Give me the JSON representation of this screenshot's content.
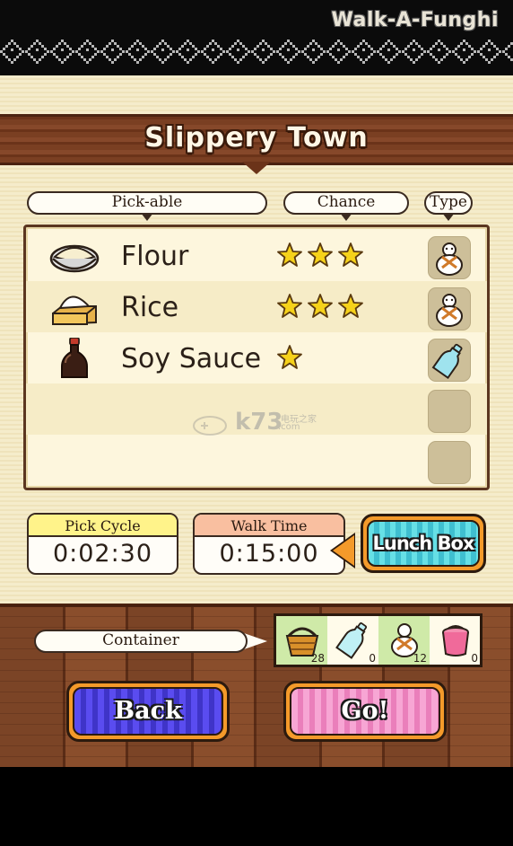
{
  "app": {
    "title": "Walk-A-Funghi"
  },
  "location": {
    "title": "Slippery Town"
  },
  "table_headers": {
    "pickable": "Pick-able",
    "chance": "Chance",
    "type": "Type"
  },
  "items": [
    {
      "name": "Flour",
      "icon": "flour-bowl-icon",
      "chance_stars": 3,
      "type_icon": "sack-icon"
    },
    {
      "name": "Rice",
      "icon": "rice-box-icon",
      "chance_stars": 3,
      "type_icon": "sack-icon"
    },
    {
      "name": "Soy Sauce",
      "icon": "soy-sauce-bottle-icon",
      "chance_stars": 1,
      "type_icon": "bottle-icon"
    },
    {
      "name": "",
      "icon": "",
      "chance_stars": 0,
      "type_icon": ""
    },
    {
      "name": "",
      "icon": "",
      "chance_stars": 0,
      "type_icon": ""
    }
  ],
  "pick_cycle": {
    "label": "Pick Cycle",
    "value": "0:02:30"
  },
  "walk_time": {
    "label": "Walk Time",
    "value": "0:15:00"
  },
  "lunch_box": {
    "label": "Lunch Box"
  },
  "container": {
    "label": "Container",
    "slots": [
      {
        "icon": "basket-icon",
        "count": "28"
      },
      {
        "icon": "bottle-icon",
        "count": "0"
      },
      {
        "icon": "sack-icon",
        "count": "12"
      },
      {
        "icon": "bucket-icon",
        "count": "0"
      }
    ]
  },
  "buttons": {
    "back": "Back",
    "go": "Go!"
  },
  "watermark": {
    "text": "k73",
    "subtext": "电玩之家",
    "domain": ".com"
  },
  "colors": {
    "accent_orange": "#f49a2a",
    "star_yellow": "#f6d21a",
    "wood_brown": "#7a3f22",
    "parchment": "#f5eccb",
    "lunch_cyan": "#66e0e6",
    "back_blue": "#5a4cf0",
    "go_pink": "#f7a6d4"
  }
}
